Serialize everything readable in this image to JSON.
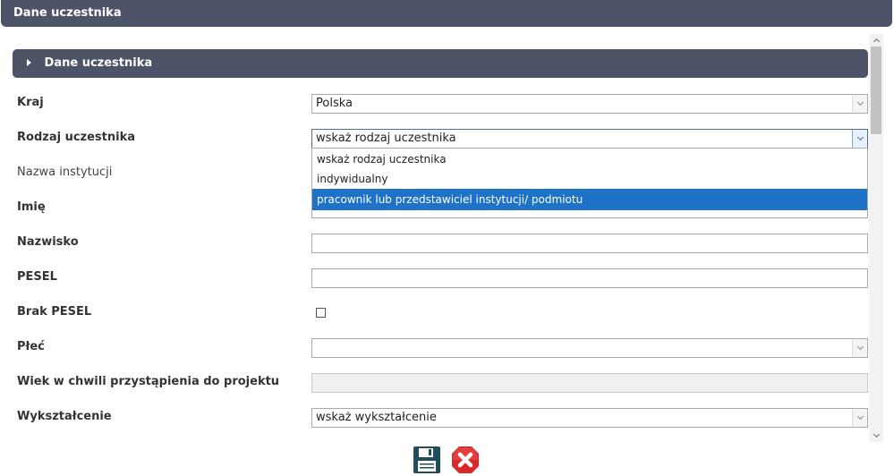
{
  "window": {
    "title": "Dane uczestnika"
  },
  "section": {
    "title": "Dane uczestnika"
  },
  "fields": {
    "kraj": {
      "label": "Kraj",
      "value": "Polska"
    },
    "rodzaj": {
      "label": "Rodzaj uczestnika",
      "value": "wskaż rodzaj uczestnika"
    },
    "instytucja": {
      "label": "Nazwa instytucji"
    },
    "imie": {
      "label": "Imię"
    },
    "nazwisko": {
      "label": "Nazwisko",
      "value": ""
    },
    "pesel": {
      "label": "PESEL",
      "value": ""
    },
    "brak_pesel": {
      "label": "Brak PESEL",
      "checked": false
    },
    "plec": {
      "label": "Płeć",
      "value": ""
    },
    "wiek": {
      "label": "Wiek w chwili przystąpienia do projektu",
      "value": ""
    },
    "wyksztalcenie": {
      "label": "Wykształcenie",
      "value": "wskaż wykształcenie"
    }
  },
  "dropdown": {
    "options": [
      "wskaż rodzaj uczestnika",
      "indywidualny",
      "pracownik lub przedstawiciel instytucji/ podmiotu"
    ],
    "highlighted_index": 2
  },
  "colors": {
    "header_bg": "#4e5468",
    "highlight": "#1e73c8",
    "save_icon": "#1f4e5a",
    "cancel_icon": "#d9292b"
  },
  "icons": {
    "save": "floppy-disk-icon",
    "cancel": "close-x-icon"
  }
}
